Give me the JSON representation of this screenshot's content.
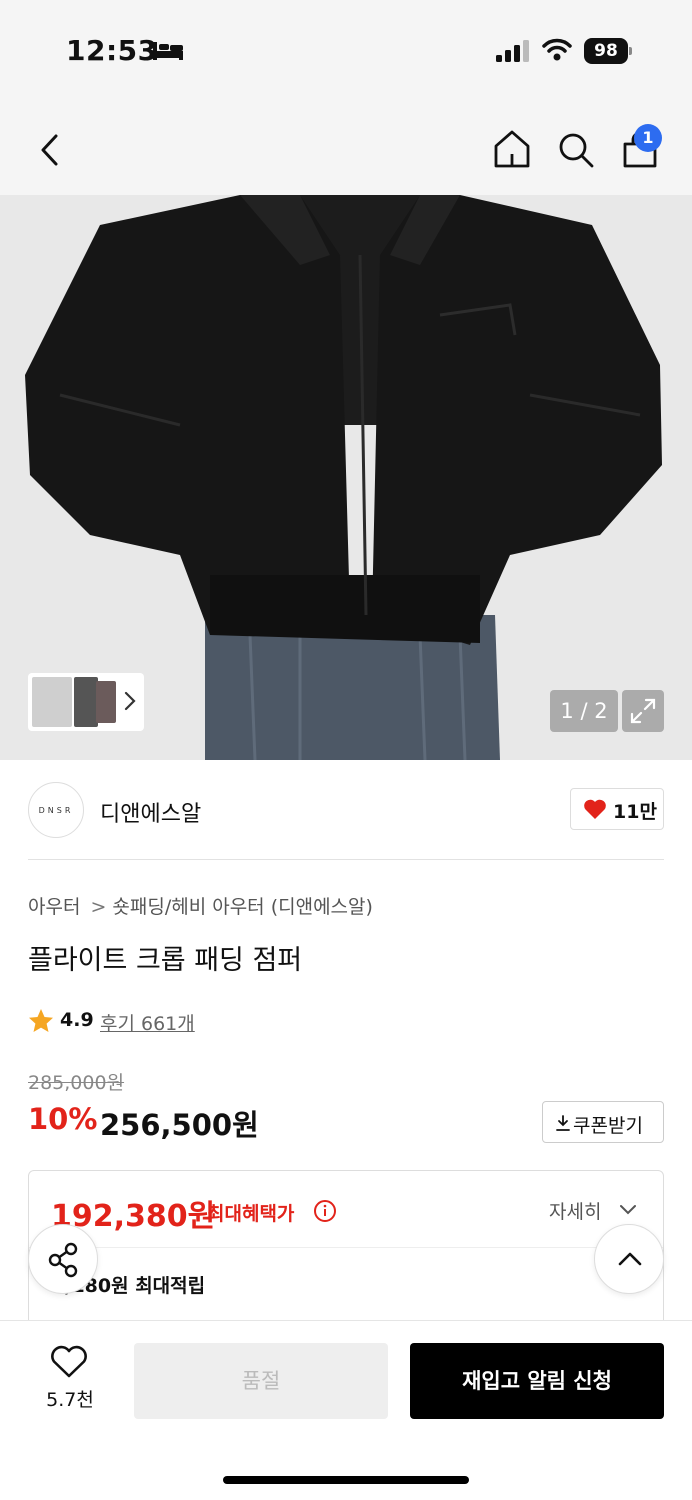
{
  "status_bar": {
    "time": "12:53",
    "battery": "98"
  },
  "nav": {
    "cart_count": "1"
  },
  "gallery": {
    "pager": "1 / 2"
  },
  "brand": {
    "logo_text": "DNSR",
    "name": "디앤에스알",
    "likes": "11만"
  },
  "product": {
    "breadcrumb": [
      "아우터",
      "숏패딩/헤비 아우터 (디앤에스알)"
    ],
    "breadcrumb_sep": ">",
    "title": "플라이트 크롭 패딩 점퍼",
    "rating": "4.9",
    "reviews": "후기 661개",
    "original_price": "285,000원",
    "discount_rate": "10%",
    "sale_price": "256,500원",
    "coupon_label": "쿠폰받기"
  },
  "benefit": {
    "max_price": "192,380원",
    "max_label": "최대혜택가",
    "details_label": "자세히",
    "points": "7,180원 최대적립"
  },
  "bottom_bar": {
    "wish_count": "5.7천",
    "soldout_label": "품절",
    "restock_label": "재입고 알림 신청"
  },
  "colors": {
    "accent_red": "#e2231a",
    "badge_blue": "#2d6cf0",
    "cta_black": "#000000"
  }
}
